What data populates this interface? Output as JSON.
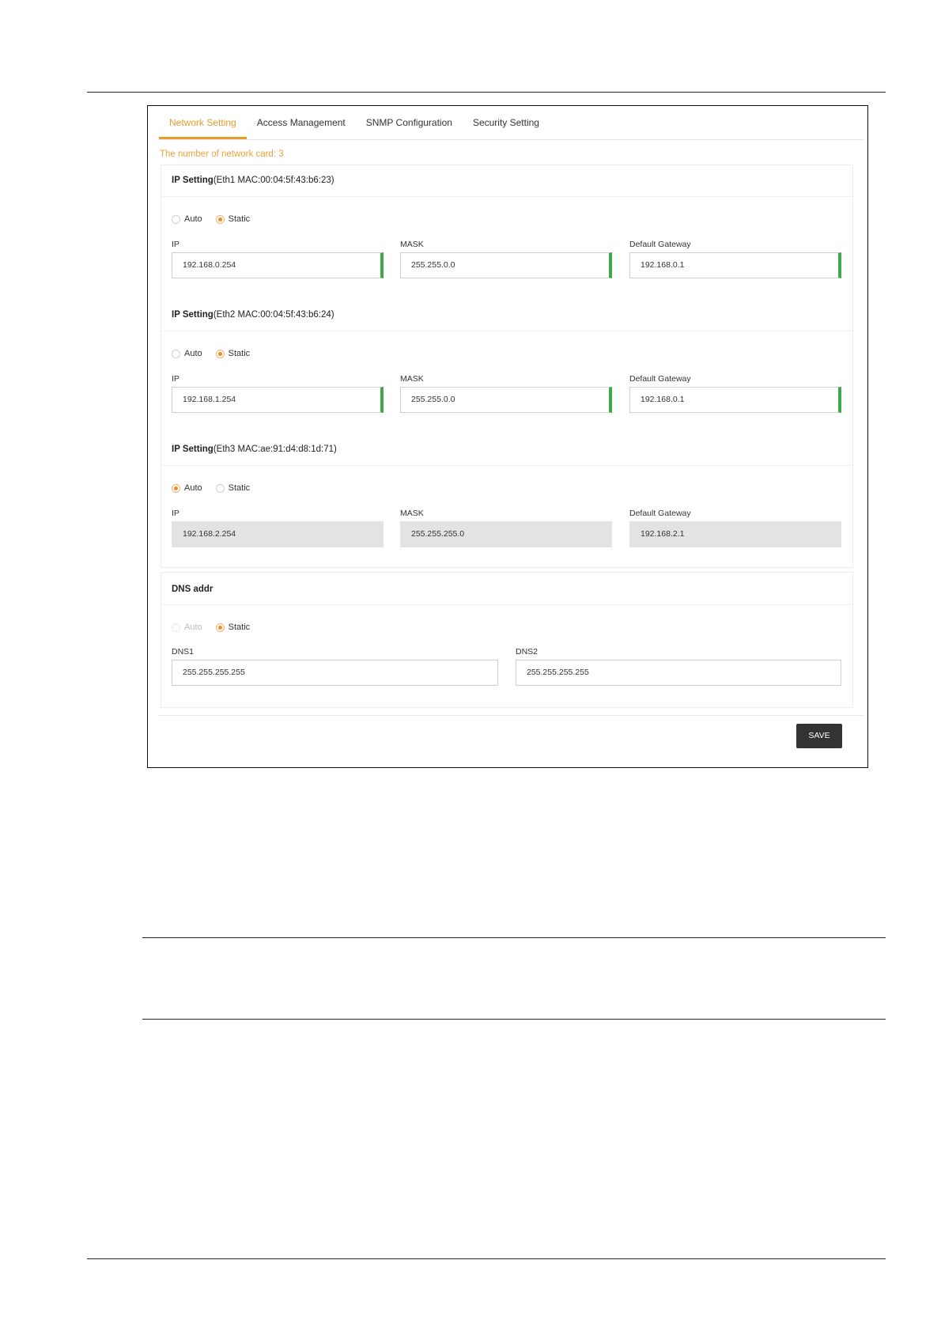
{
  "tabs": [
    {
      "label": "Network Setting",
      "active": true
    },
    {
      "label": "Access Management",
      "active": false
    },
    {
      "label": "SNMP Configuration",
      "active": false
    },
    {
      "label": "Security Setting",
      "active": false
    }
  ],
  "card_count": "The number of network card: 3",
  "eth": [
    {
      "title_bold": "IP Setting",
      "title_rest": "(Eth1 MAC:00:04:5f:43:b6:23)",
      "auto_label": "Auto",
      "static_label": "Static",
      "mode": "static",
      "ip_label": "IP",
      "ip": "192.168.0.254",
      "mask_label": "MASK",
      "mask": "255.255.0.0",
      "gw_label": "Default Gateway",
      "gw": "192.168.0.1"
    },
    {
      "title_bold": "IP Setting",
      "title_rest": "(Eth2 MAC:00:04:5f:43:b6:24)",
      "auto_label": "Auto",
      "static_label": "Static",
      "mode": "static",
      "ip_label": "IP",
      "ip": "192.168.1.254",
      "mask_label": "MASK",
      "mask": "255.255.0.0",
      "gw_label": "Default Gateway",
      "gw": "192.168.0.1"
    },
    {
      "title_bold": "IP Setting",
      "title_rest": "(Eth3 MAC:ae:91:d4:d8:1d:71)",
      "auto_label": "Auto",
      "static_label": "Static",
      "mode": "auto",
      "ip_label": "IP",
      "ip": "192.168.2.254",
      "mask_label": "MASK",
      "mask": "255.255.255.0",
      "gw_label": "Default Gateway",
      "gw": "192.168.2.1"
    }
  ],
  "dns": {
    "title": "DNS addr",
    "auto_label": "Auto",
    "static_label": "Static",
    "mode": "static",
    "dns1_label": "DNS1",
    "dns1": "255.255.255.255",
    "dns2_label": "DNS2",
    "dns2": "255.255.255.255"
  },
  "save_label": "SAVE",
  "colors": {
    "accent": "#e99b2a",
    "valid": "#3fa84a",
    "button": "#333333"
  }
}
